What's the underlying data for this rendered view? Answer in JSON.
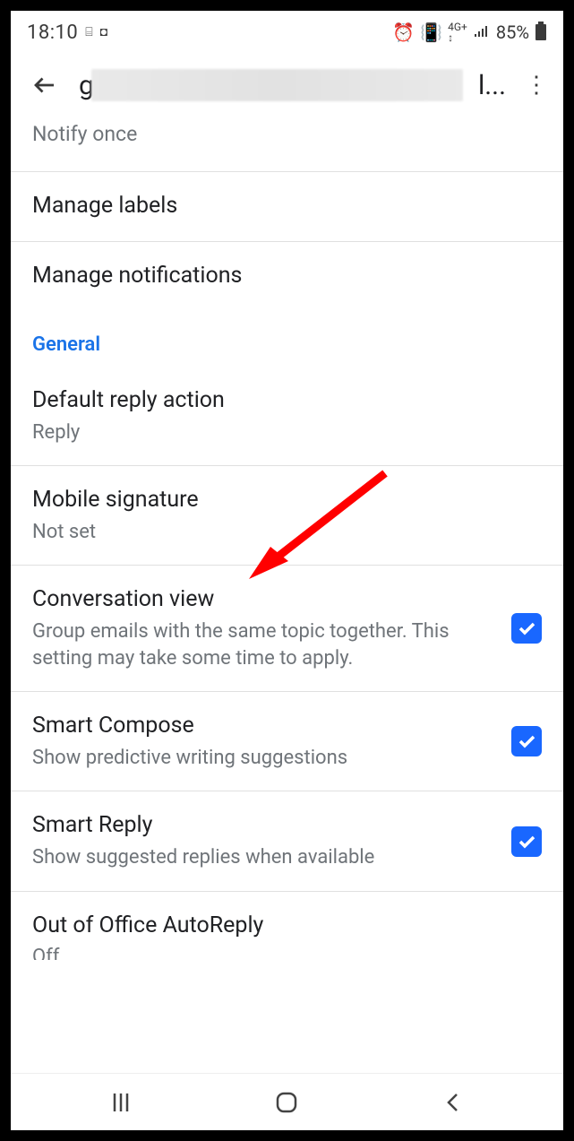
{
  "status": {
    "time": "18:10",
    "battery": "85%"
  },
  "appbar": {
    "title_initial": "g",
    "title_ellipsis": "l...",
    "more_glyph": "⋮"
  },
  "notify_once": "Notify once",
  "nav_items": {
    "manage_labels": "Manage labels",
    "manage_notifications": "Manage notifications"
  },
  "section_header": "General",
  "settings": {
    "default_reply": {
      "title": "Default reply action",
      "value": "Reply"
    },
    "mobile_signature": {
      "title": "Mobile signature",
      "value": "Not set"
    },
    "conversation_view": {
      "title": "Conversation view",
      "desc": "Group emails with the same topic together. This setting may take some time to apply.",
      "checked": true
    },
    "smart_compose": {
      "title": "Smart Compose",
      "desc": "Show predictive writing suggestions",
      "checked": true
    },
    "smart_reply": {
      "title": "Smart Reply",
      "desc": "Show suggested replies when available",
      "checked": true
    },
    "ooo": {
      "title": "Out of Office AutoReply",
      "value": "Off"
    }
  }
}
